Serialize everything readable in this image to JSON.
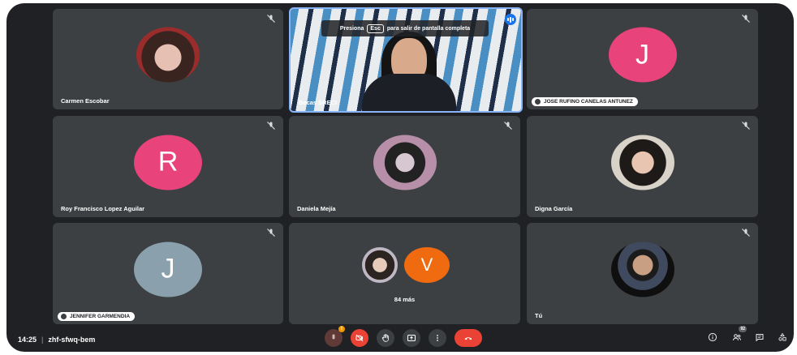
{
  "meeting": {
    "time": "14:25",
    "separator": "|",
    "code": "zhf-sfwq-bem"
  },
  "banner": {
    "pre": "Presiona",
    "key": "Esc",
    "post": "para salir de pantalla completa"
  },
  "participants": {
    "carmen": {
      "name": "Carmen Escobar"
    },
    "presenter": {
      "name": "Becas SRECI"
    },
    "jose": {
      "name": "JOSE RUFINO CANELAS ANTUNEZ",
      "initial": "J",
      "color": "#e8437a"
    },
    "roy": {
      "name": "Roy Francisco Lopez Aguilar",
      "initial": "R",
      "color": "#e8437a"
    },
    "daniela": {
      "name": "Daniela Mejía"
    },
    "digna": {
      "name": "Digna García"
    },
    "jennifer": {
      "name": "JENNIFER GARMENDIA",
      "initial": "J",
      "color": "#8aa0ad"
    },
    "others": {
      "initial": "V",
      "color": "#f06a0f",
      "label": "84 más"
    },
    "self": {
      "name": "Tú"
    }
  },
  "controls": {
    "mic_badge": "!",
    "people_count": "92"
  },
  "colors": {
    "background": "#202124",
    "tile": "#3c4043",
    "end_call": "#ea4335",
    "active_border": "#8ab4f8"
  }
}
